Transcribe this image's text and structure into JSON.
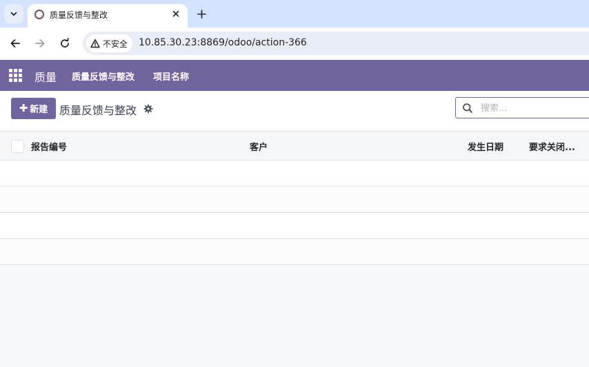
{
  "browser": {
    "tab": {
      "title": "质量反馈与整改",
      "favicon": "odoo-circle-icon"
    },
    "security_label": "不安全",
    "url": "10.85.30.23:8869/odoo/action-366"
  },
  "navbar": {
    "app_name": "质量",
    "menu_items": [
      {
        "label": "质量反馈与整改"
      },
      {
        "label": "项目名称"
      }
    ],
    "color": "#71639e"
  },
  "control_panel": {
    "new_button_label": "新建",
    "breadcrumb_title": "质量反馈与整改",
    "search_placeholder": "搜索..."
  },
  "list": {
    "columns": [
      {
        "label": "报告编号"
      },
      {
        "label": "客户"
      },
      {
        "label": "发生日期"
      },
      {
        "label": "要求关闭..."
      }
    ],
    "empty_rows": 4
  }
}
